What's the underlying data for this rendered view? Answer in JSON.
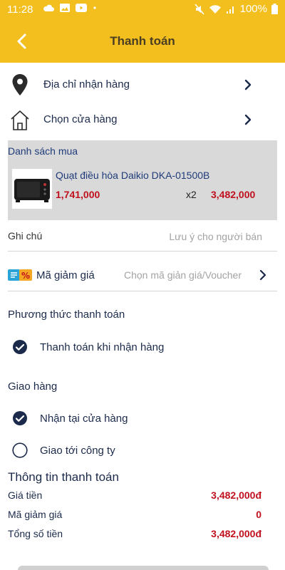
{
  "status_bar": {
    "time": "11:28",
    "battery": "100%",
    "left_icons": [
      "cloud-icon",
      "image-icon",
      "youtube-icon",
      "dot-icon"
    ],
    "right_icons": [
      "mute-icon",
      "wifi-icon",
      "signal-icon",
      "battery-icon"
    ]
  },
  "header": {
    "title": "Thanh toán",
    "background": "#f2bf1f"
  },
  "address_row": {
    "label": "Địa chỉ nhận hàng",
    "icon": "location-pin-icon"
  },
  "store_row": {
    "label": "Chọn cửa hàng",
    "icon": "store-icon"
  },
  "cart": {
    "header": "Danh sách mua",
    "items": [
      {
        "name": "Quạt điều hòa Daikio DKA-01500B",
        "unit_price": "1,741,000",
        "quantity": "x2",
        "line_total": "3,482,000"
      }
    ]
  },
  "note": {
    "label": "Ghi chú",
    "placeholder": "Lưu ý cho người bán",
    "value": ""
  },
  "voucher": {
    "label": "Mã giảm giá",
    "value": "Chọn mã giản giá/Voucher",
    "icon": "voucher-icon"
  },
  "payment_method": {
    "title": "Phương thức thanh toán",
    "options": [
      {
        "label": "Thanh toán khi nhận hàng",
        "selected": true
      }
    ]
  },
  "delivery": {
    "title": "Giao hàng",
    "options": [
      {
        "label": "Nhận tại cửa hàng",
        "selected": true
      },
      {
        "label": "Giao tới công ty",
        "selected": false
      }
    ]
  },
  "payment_info": {
    "title": "Thông tin thanh toán",
    "rows": [
      {
        "label": "Giá tiền",
        "value": "3,482,000đ"
      },
      {
        "label": "Mã giảm giá",
        "value": "0"
      },
      {
        "label": "Tổng số tiền",
        "value": "3,482,000đ"
      }
    ]
  },
  "colors": {
    "accent": "#f2bf1f",
    "price_red": "#c0101d",
    "text_navy": "#1b2a4a",
    "cart_bg": "#d9d9d9"
  }
}
